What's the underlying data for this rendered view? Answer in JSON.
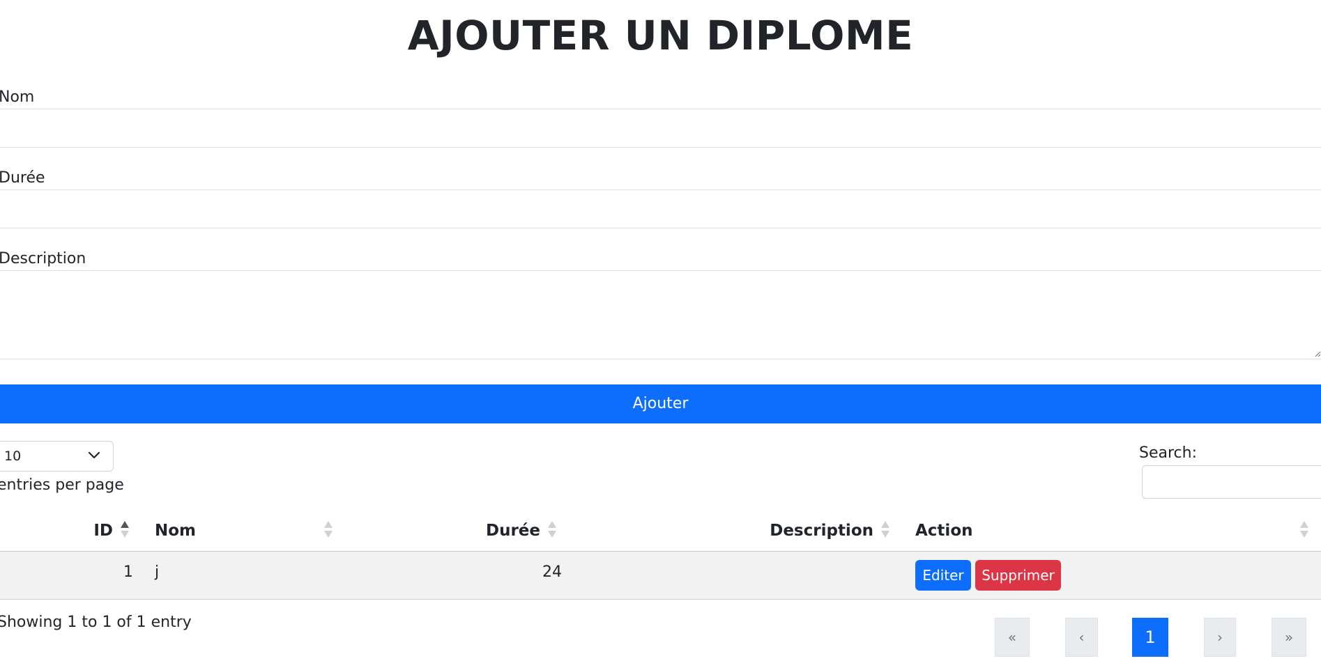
{
  "page": {
    "title": "AJOUTER UN DIPLOME"
  },
  "form": {
    "fields": [
      {
        "label": "Nom",
        "value": ""
      },
      {
        "label": "Durée",
        "value": ""
      },
      {
        "label": "Description",
        "value": ""
      }
    ],
    "submit_label": "Ajouter"
  },
  "table_controls": {
    "per_page_value": "10",
    "per_page_label": "entries per page",
    "search_label": "Search:",
    "search_value": ""
  },
  "table": {
    "columns": [
      "ID",
      "Nom",
      "Durée",
      "Description",
      "Action"
    ],
    "sorted_column": "ID",
    "rows": [
      {
        "id": "1",
        "nom": "j",
        "duree": "24",
        "description": ""
      }
    ],
    "actions": {
      "edit_label": "Editer",
      "delete_label": "Supprimer"
    }
  },
  "footer": {
    "info": "Showing 1 to 1 of 1 entry",
    "pagination": {
      "first": "«",
      "prev": "‹",
      "current": "1",
      "next": "›",
      "last": "»"
    }
  },
  "colors": {
    "primary": "#0d6efd",
    "danger": "#dc3545",
    "sort_active": "#555555",
    "sort_inactive": "#d0d0d0"
  },
  "icons": {
    "sort": "sort-icon",
    "dropdown": "chevron-down-icon",
    "resize": "resize-grip-icon"
  }
}
